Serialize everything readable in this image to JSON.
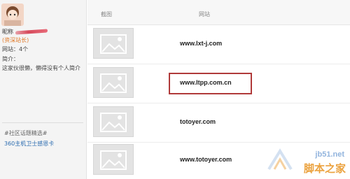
{
  "sidebar": {
    "nick_label": "昵称",
    "level": "(资深站长)",
    "site_count": "网站：4个",
    "intro_label": "简介：",
    "intro_text": "这家伙很懒，懒得没有个人简介",
    "topic_title": "#社区话题精选#",
    "topic_link": "360主机卫士感恩卡"
  },
  "table": {
    "headers": {
      "screenshot": "截图",
      "site": "网站"
    },
    "rows": [
      {
        "site": "www.lxt-j.com"
      },
      {
        "site": "www.ltpp.com.cn",
        "highlighted": true
      },
      {
        "site": "totoyer.com"
      },
      {
        "site": "www.totoyer.com"
      }
    ]
  },
  "watermark": {
    "domain": "jb51.net",
    "name": "脚本之家"
  },
  "colors": {
    "highlight_border": "#b03a3a",
    "link": "#2b6cb0",
    "level": "#e07a2a"
  }
}
